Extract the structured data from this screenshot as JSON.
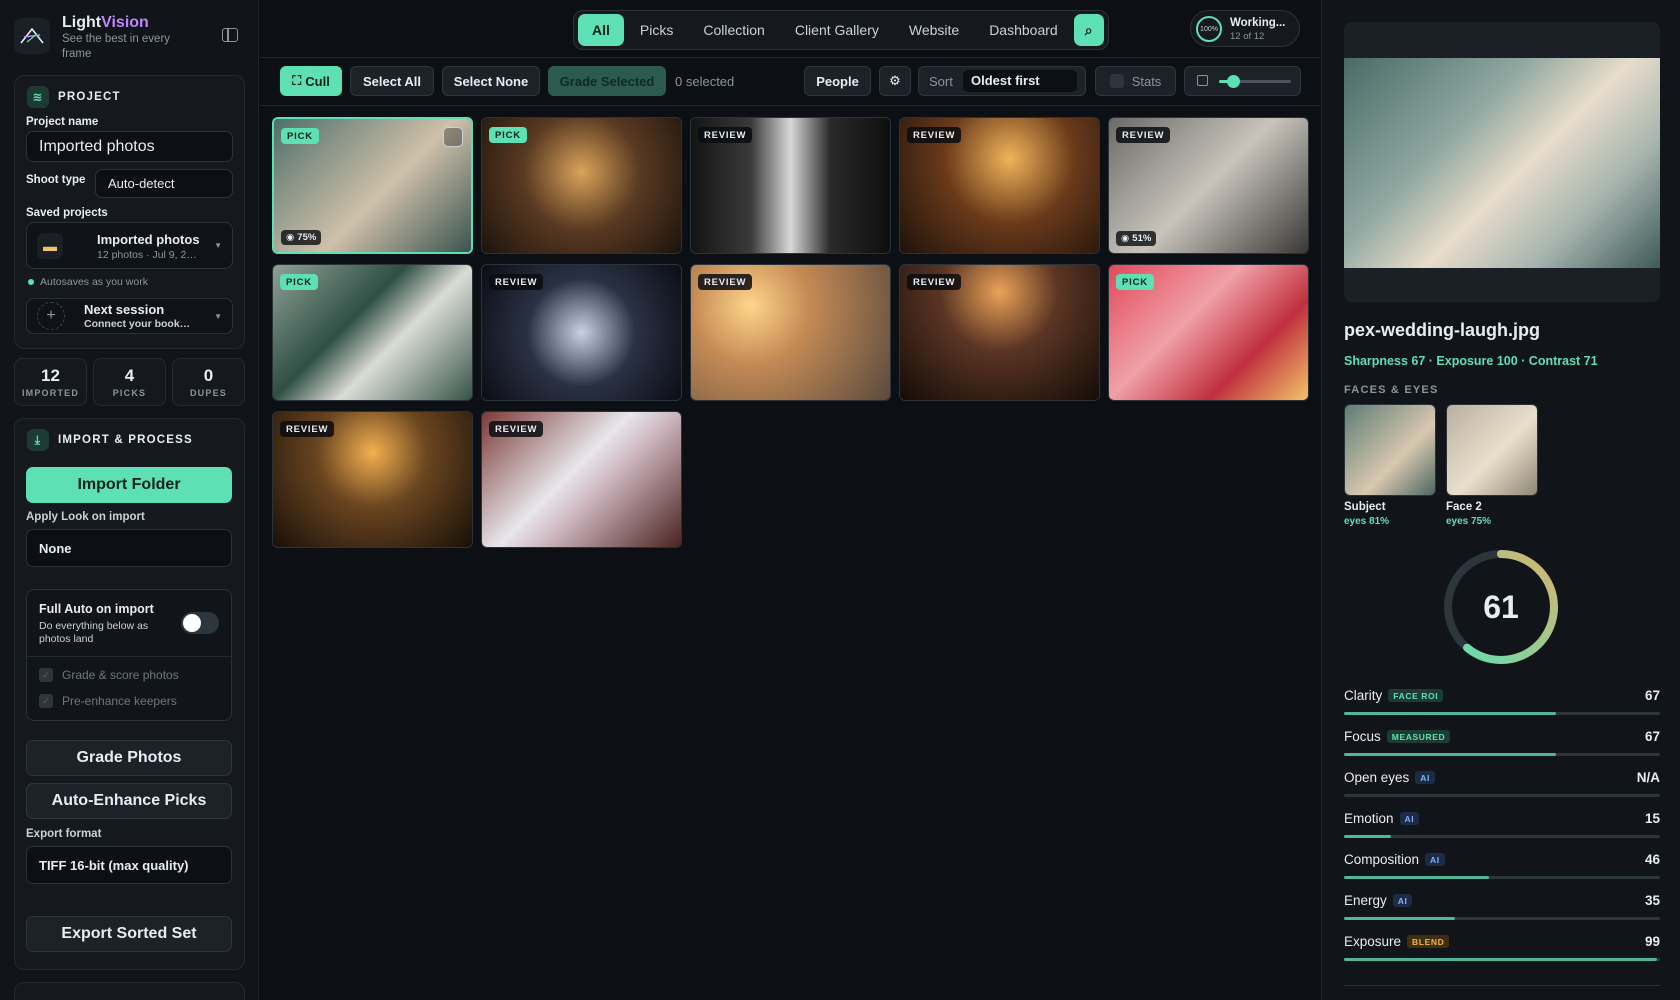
{
  "app": {
    "brand_light": "Light",
    "brand_vision": "Vision",
    "tagline": "See the best in every frame"
  },
  "project": {
    "section_title": "PROJECT",
    "name_label": "Project name",
    "name_value": "Imported photos",
    "shoot_type_label": "Shoot type",
    "shoot_type_value": "Auto-detect",
    "saved_label": "Saved projects",
    "saved_item": {
      "title": "Imported photos",
      "subtitle": "12 photos · Jul 9, 2…"
    },
    "autosave": "Autosaves as you work",
    "next_session": {
      "title": "Next session",
      "subtitle": "Connect your book…"
    }
  },
  "stats": [
    {
      "value": "12",
      "label": "IMPORTED"
    },
    {
      "value": "4",
      "label": "PICKS"
    },
    {
      "value": "0",
      "label": "DUPES"
    }
  ],
  "import": {
    "section_title": "IMPORT & PROCESS",
    "import_button": "Import Folder",
    "look_label": "Apply Look on import",
    "look_value": "None",
    "full_auto_title": "Full Auto on import",
    "full_auto_sub": "Do everything below as photos land",
    "full_auto_on": false,
    "opt1": "Grade & score photos",
    "opt2": "Pre-enhance keepers",
    "grade_button": "Grade Photos",
    "enhance_button": "Auto-Enhance Picks",
    "export_label": "Export format",
    "export_value": "TIFF 16-bit (max quality)",
    "export_button": "Export Sorted Set"
  },
  "tabs": [
    "All",
    "Picks",
    "Collection",
    "Client Gallery",
    "Website",
    "Dashboard"
  ],
  "active_tab": "All",
  "search_icon": "search-icon",
  "status": {
    "ring": "100%",
    "title": "Working...",
    "sub": "12 of 12"
  },
  "toolbar": {
    "cull": "Cull",
    "select_all": "Select All",
    "select_none": "Select None",
    "grade_selected": "Grade Selected",
    "selected_count": "0 selected",
    "people": "People",
    "sort_label": "Sort",
    "sort_value": "Oldest first",
    "stats": "Stats",
    "thumb_size": 0.2
  },
  "photos": [
    {
      "badge": "PICK",
      "eyes": "75%",
      "selected": true,
      "checkbox": true
    },
    {
      "badge": "PICK"
    },
    {
      "badge": "REVIEW"
    },
    {
      "badge": "REVIEW"
    },
    {
      "badge": "REVIEW",
      "eyes": "51%"
    },
    {
      "badge": "PICK"
    },
    {
      "badge": "REVIEW"
    },
    {
      "badge": "REVIEW"
    },
    {
      "badge": "REVIEW"
    },
    {
      "badge": "PICK"
    },
    {
      "badge": "REVIEW"
    },
    {
      "badge": "REVIEW"
    }
  ],
  "detail": {
    "filename": "pex-wedding-laugh.jpg",
    "metrics": "Sharpness 67 · Exposure 100 · Contrast 71",
    "faces_title": "FACES & EYES",
    "faces": [
      {
        "label": "Subject",
        "eyes": "eyes 81%"
      },
      {
        "label": "Face 2",
        "eyes": "eyes 75%"
      }
    ],
    "score": "61",
    "score_value": 61,
    "rows": [
      {
        "name": "Clarity",
        "tag": "FACE ROI",
        "tag_kind": "roi",
        "value": "67",
        "fill": 0.67
      },
      {
        "name": "Focus",
        "tag": "MEASURED",
        "tag_kind": "roi",
        "value": "67",
        "fill": 0.67
      },
      {
        "name": "Open eyes",
        "tag": "AI",
        "tag_kind": "ai",
        "value": "N/A",
        "fill": 0
      },
      {
        "name": "Emotion",
        "tag": "AI",
        "tag_kind": "ai",
        "value": "15",
        "fill": 0.15
      },
      {
        "name": "Composition",
        "tag": "AI",
        "tag_kind": "ai",
        "value": "46",
        "fill": 0.46
      },
      {
        "name": "Energy",
        "tag": "AI",
        "tag_kind": "ai",
        "value": "35",
        "fill": 0.35
      },
      {
        "name": "Exposure",
        "tag": "BLEND",
        "tag_kind": "blend",
        "value": "99",
        "fill": 0.99
      }
    ]
  },
  "colors": {
    "accent": "#5ee0b5",
    "brand_accent": "#c084fc",
    "bg": "#0c1014"
  }
}
